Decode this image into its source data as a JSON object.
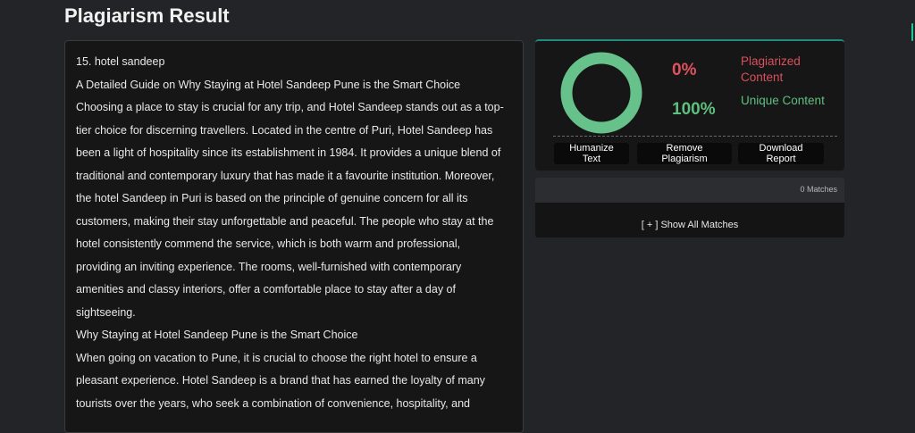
{
  "page": {
    "title": "Plagiarism Result"
  },
  "document": {
    "lines": [
      "15. hotel sandeep",
      "A Detailed Guide on Why Staying at Hotel Sandeep Pune is the Smart Choice",
      "Choosing a place to stay is crucial for any trip, and Hotel Sandeep stands out as a top-",
      "tier choice for discerning travellers. Located in the centre of Puri, Hotel Sandeep has",
      "been a light of hospitality since its establishment in 1984. It provides a unique blend of",
      "traditional and contemporary luxury that has made it a favourite institution. Moreover,",
      "the hotel Sandeep in Puri is based on the principle of genuine concern for all its",
      "customers, making their stay unforgettable and peaceful. The people who stay at the",
      "hotel consistently commend the service, which is both warm and professional,",
      "providing an inviting experience. The rooms, well-furnished with contemporary",
      "amenities and classy interiors, offer a comfortable place to stay after a day of",
      "sightseeing.",
      "Why Staying at Hotel Sandeep Pune is the Smart Choice",
      "When going on vacation to Pune, it is crucial to choose the right hotel to ensure a",
      "pleasant experience. Hotel Sandeep is a brand that has earned the loyalty of many",
      "tourists over the years, who seek a combination of convenience, hospitality, and"
    ]
  },
  "result": {
    "plagiarized_percent": "0%",
    "plagiarized_label": "Plagiarized Content",
    "unique_percent": "100%",
    "unique_label": "Unique Content",
    "unique_fraction": 1.0,
    "colors": {
      "unique": "#66c28a",
      "plagiarized": "#e05260"
    }
  },
  "actions": {
    "humanize_label": "Humanize Text",
    "remove_label": "Remove Plagiarism",
    "download_label": "Download Report"
  },
  "matches": {
    "count_text": "0 Matches",
    "show_all_label": "[ + ] Show All Matches"
  },
  "icons": {
    "donut": "unique-content-donut-icon"
  }
}
